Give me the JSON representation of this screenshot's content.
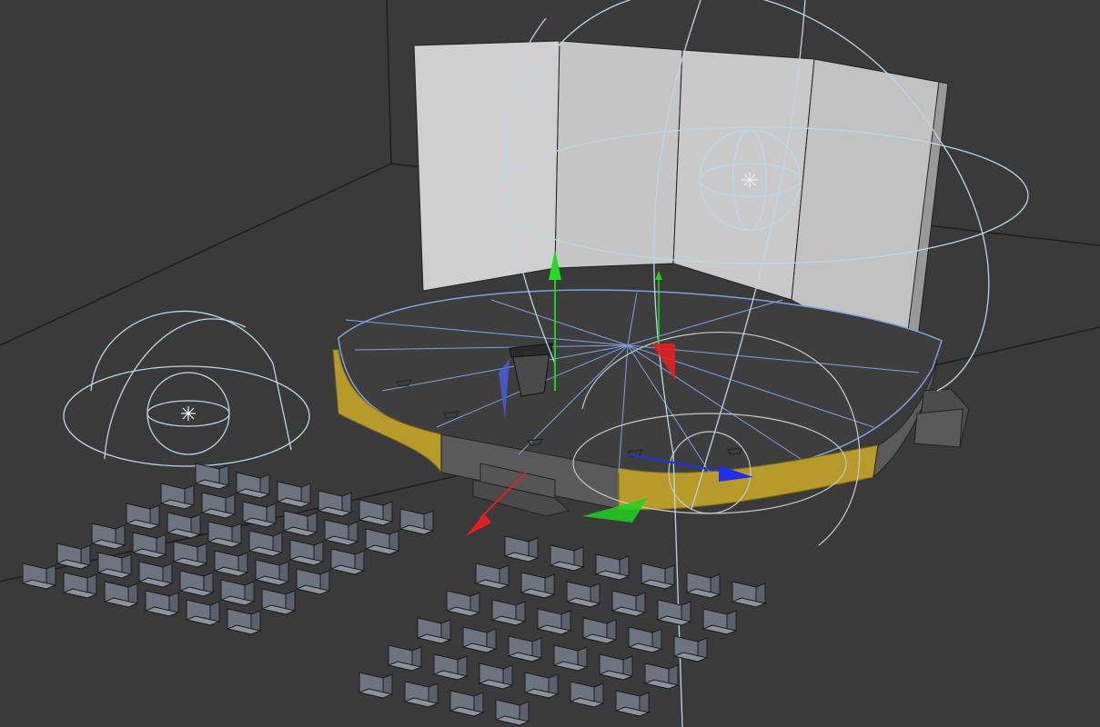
{
  "app": {
    "view": "3D viewport"
  },
  "colors": {
    "background": "#3a3a3a",
    "room_line": "#1e1e1e",
    "screen_face": "#c9c9c9",
    "stage_top": "#3e3e3e",
    "stage_side": "#5a5a5a",
    "stage_accent": "#b89a2a",
    "selection_wire": "#7fa0e0",
    "light_gizmo": "#b8d8e6",
    "chair": "#6c7480",
    "axis_x": "#e02020",
    "axis_y": "#20d020",
    "axis_z": "#2030e8"
  },
  "scene": {
    "objects": [
      {
        "name": "backdrop-screen",
        "panels": 4
      },
      {
        "name": "stage-platform",
        "shape": "semicircle"
      },
      {
        "name": "podium"
      },
      {
        "name": "stage-steps",
        "count": 2
      },
      {
        "name": "omni-light",
        "count": 3
      },
      {
        "name": "chair-group-left",
        "rows": 6,
        "cols": 6
      },
      {
        "name": "chair-group-right",
        "rows": 6,
        "cols": 6
      }
    ],
    "gizmos": [
      "move-gizmo-main",
      "move-gizmo-small",
      "rotate-gizmo-stage"
    ]
  }
}
